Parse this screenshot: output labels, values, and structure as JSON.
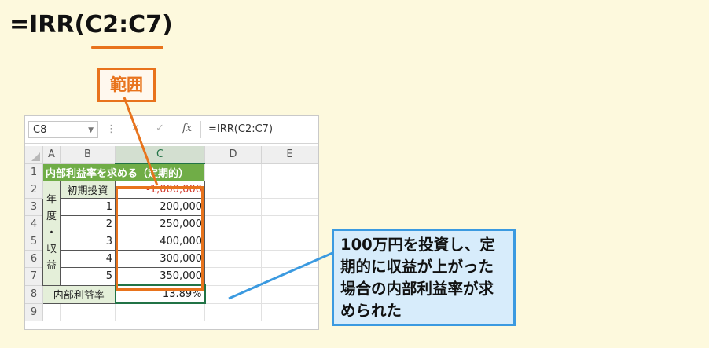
{
  "formula": "=IRR(C2:C7)",
  "range_label": "範囲",
  "callout": "100万円を投資し、定期的に収益が上がった場合の内部利益率が求められた",
  "formula_bar": {
    "name_box": "C8",
    "formula": "=IRR(C2:C7)",
    "fx": "fx"
  },
  "columns": [
    "A",
    "B",
    "C",
    "D",
    "E"
  ],
  "rows": [
    "1",
    "2",
    "3",
    "4",
    "5",
    "6",
    "7",
    "8",
    "9"
  ],
  "sheet": {
    "title": "内部利益率を求める（定期的）",
    "a_label": [
      "年",
      "度",
      "・",
      "収",
      "益"
    ],
    "b_values": [
      "初期投資",
      "1",
      "2",
      "3",
      "4",
      "5"
    ],
    "c_values": [
      "-1,000,000",
      "200,000",
      "250,000",
      "400,000",
      "300,000",
      "350,000"
    ],
    "result_label": "内部利益率",
    "result_value": "13.89%"
  },
  "colors": {
    "orange_accent": "#e8731c",
    "blue_callout": "#3b9ae0",
    "header_green": "#70ad47",
    "light_green": "#e4efd9",
    "negative_red": "#d1392b"
  }
}
